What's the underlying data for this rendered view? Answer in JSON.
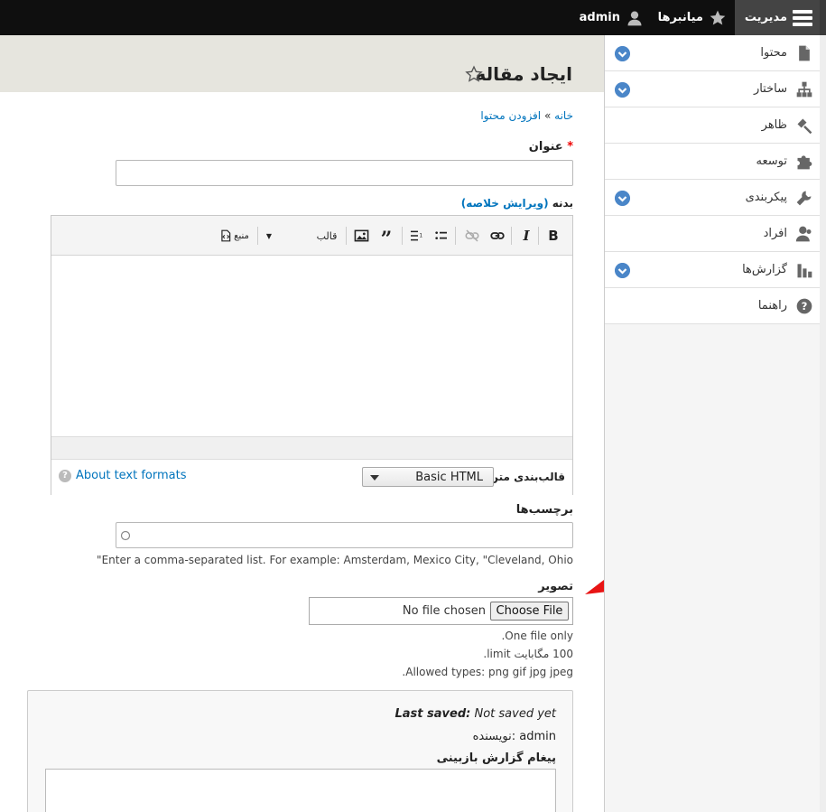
{
  "toolbar": {
    "manage_label": "مدیریت",
    "shortcuts_label": "میانبرها",
    "user_label": "admin"
  },
  "page": {
    "title": "ایجاد مقاله",
    "breadcrumb_home": "خانه",
    "breadcrumb_sep": "»",
    "breadcrumb_add": "افزودن محتوا"
  },
  "form": {
    "title_label": "عنوان",
    "required_mark": "*",
    "body_label": "بدنه",
    "body_summary_link": "(ویرایش خلاصه)",
    "editor": {
      "bold": "B",
      "italic": "I",
      "format_label": "قالب",
      "source_label": "منبع"
    },
    "text_format_label": "قالب‌بندی متن",
    "text_format_value": "Basic HTML",
    "about_formats": "About text formats",
    "tags_label": "برچسب‌ها",
    "tags_help": "Enter a comma-separated list. For example: Amsterdam, Mexico City, \"Cleveland, Ohio\"",
    "image_label": "تصویر",
    "choose_file": "Choose File",
    "no_file": "No file chosen",
    "image_help_1": "One file only.",
    "image_help_2": "100 مگابایت limit.",
    "image_help_3": "Allowed types: png gif jpg jpeg.",
    "last_saved_label": "Last saved:",
    "last_saved_value": "Not saved yet",
    "author_label": "نویسنده:",
    "author_value": "admin",
    "revision_label": "پیغام گزارش بازبینی"
  },
  "tray": {
    "items": [
      {
        "label": "محتوا",
        "icon": "file-icon",
        "expandable": true
      },
      {
        "label": "ساختار",
        "icon": "sitemap-icon",
        "expandable": true
      },
      {
        "label": "ظاهر",
        "icon": "brush-icon",
        "expandable": false
      },
      {
        "label": "توسعه",
        "icon": "puzzle-icon",
        "expandable": false
      },
      {
        "label": "پیکربندی",
        "icon": "wrench-icon",
        "expandable": true
      },
      {
        "label": "افراد",
        "icon": "people-icon",
        "expandable": false
      },
      {
        "label": "گزارش‌ها",
        "icon": "bar-chart-icon",
        "expandable": true
      },
      {
        "label": "راهنما",
        "icon": "help-icon",
        "expandable": false
      }
    ]
  },
  "colors": {
    "accent": "#0074bd",
    "arrow": "#e81414",
    "toolbar_bg": "#0f0f0f",
    "chevron": "#4a86c8"
  }
}
